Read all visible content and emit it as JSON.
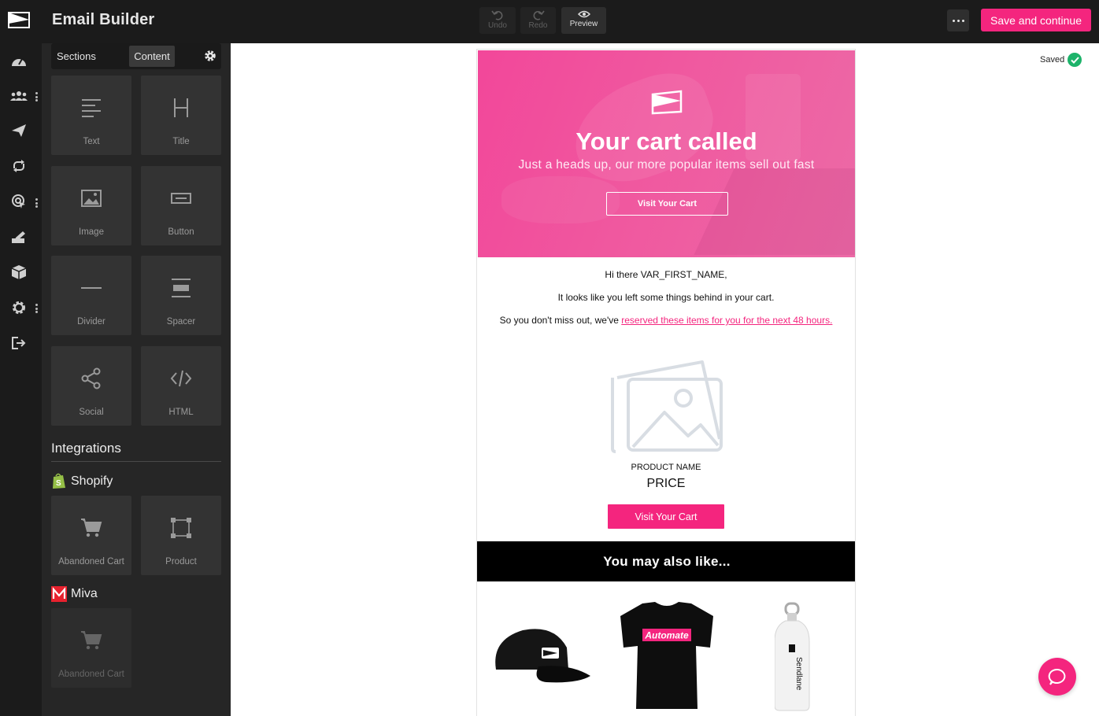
{
  "app": {
    "title": "Email Builder"
  },
  "toolbar": {
    "undo_label": "Undo",
    "redo_label": "Redo",
    "preview_label": "Preview",
    "save_label": "Save and continue"
  },
  "panel": {
    "tabs": [
      "Sections",
      "Content"
    ],
    "active_tab": "Content",
    "blocks": [
      {
        "label": "Text",
        "icon": "text-icon"
      },
      {
        "label": "Title",
        "icon": "title-icon"
      },
      {
        "label": "Image",
        "icon": "image-icon"
      },
      {
        "label": "Button",
        "icon": "button-icon"
      },
      {
        "label": "Divider",
        "icon": "divider-icon"
      },
      {
        "label": "Spacer",
        "icon": "spacer-icon"
      },
      {
        "label": "Social",
        "icon": "share-icon"
      },
      {
        "label": "HTML",
        "icon": "code-icon"
      }
    ],
    "integrations_heading": "Integrations",
    "shopify": {
      "name": "Shopify",
      "blocks": [
        {
          "label": "Abandoned Cart",
          "icon": "cart-icon"
        },
        {
          "label": "Product",
          "icon": "product-frame-icon"
        }
      ]
    },
    "miva": {
      "name": "Miva",
      "blocks": [
        {
          "label": "Abandoned Cart",
          "icon": "cart-icon",
          "disabled": true
        }
      ]
    }
  },
  "status": {
    "saved_label": "Saved"
  },
  "email": {
    "hero": {
      "title": "Your cart called",
      "subtitle": "Just a heads up, our more popular items sell out fast",
      "button_label": "Visit Your Cart"
    },
    "greeting": "Hi there VAR_FIRST_NAME,",
    "line2": "It looks like you left some things behind in your cart.",
    "line3_prefix": "So you don't miss out, we've ",
    "line3_link": "reserved these items for you for the next 48 hours.",
    "product": {
      "name": "PRODUCT NAME",
      "price": "PRICE",
      "button_label": "Visit Your Cart"
    },
    "also_heading": "You may also like...",
    "related": [
      {
        "name": "cap",
        "print": ""
      },
      {
        "name": "t-shirt",
        "print": "Automate"
      },
      {
        "name": "water-bottle",
        "print": "Sendlane"
      }
    ]
  },
  "colors": {
    "accent": "#f4257e",
    "sidebar_bg": "#262626",
    "topbar_bg": "#1b1b1b",
    "saved_green": "#1db36a"
  }
}
